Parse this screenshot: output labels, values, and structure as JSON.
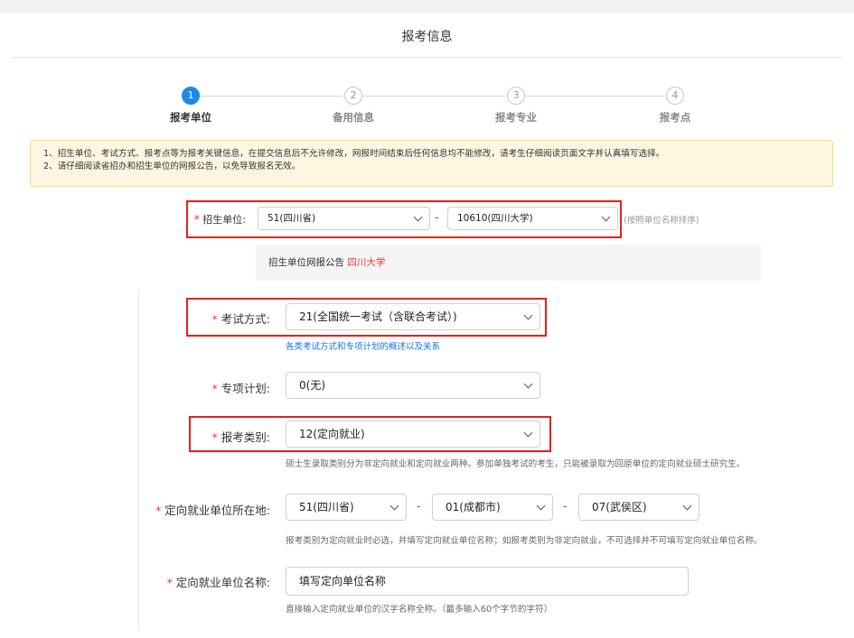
{
  "page_title": "报考信息",
  "steps": [
    {
      "number": "1",
      "label": "报考单位",
      "active": true
    },
    {
      "number": "2",
      "label": "备用信息",
      "active": false
    },
    {
      "number": "3",
      "label": "报考专业",
      "active": false
    },
    {
      "number": "4",
      "label": "报考点",
      "active": false
    }
  ],
  "notice": {
    "line1": "1、招生单位、考试方式、报考点等为报考关键信息，在提交信息后不允许修改，网报时间结束后任何信息均不能修改，请考生仔细阅读页面文字并认真填写选择。",
    "line2": "2、请仔细阅读省招办和招生单位的网报公告，以免导致报名无效。"
  },
  "required_mark": "*",
  "separator": "-",
  "form": {
    "unit": {
      "label": "招生单位:",
      "province_value": "51(四川省)",
      "school_value": "10610(四川大学)",
      "sort_hint": "(按照单位名称排序)"
    },
    "announcement": {
      "prefix": "招生单位网报公告",
      "school": "四川大学"
    },
    "exam_mode": {
      "label": "考试方式:",
      "value": "21(全国统一考试（含联合考试）)",
      "link": "各类考试方式和专项计划的概述以及关系"
    },
    "special_plan": {
      "label": "专项计划:",
      "value": "0(无)"
    },
    "category": {
      "label": "报考类别:",
      "value": "12(定向就业)",
      "hint": "硕士生录取类别分为非定向就业和定向就业两种。参加单独考试的考生，只能被录取为回原单位的定向就业硕士研究生。"
    },
    "employer_location": {
      "label": "定向就业单位所在地:",
      "province_value": "51(四川省)",
      "city_value": "01(成都市)",
      "district_value": "07(武侯区)",
      "hint": "报考类别为定向就业时必选，并填写定向就业单位名称；如报考类别为非定向就业，不可选择并不可填写定向就业单位名称。"
    },
    "employer_name": {
      "label": "定向就业单位名称:",
      "value": "填写定向单位名称",
      "hint": "直接输入定向就业单位的汉字名称全称。（最多输入60个字节的字符）"
    }
  },
  "colors": {
    "active_step": "#1a8be8",
    "required": "#e33333",
    "highlight_box": "#e3211c",
    "link": "#1a73e8",
    "notice_bg": "#fdf6e1"
  }
}
